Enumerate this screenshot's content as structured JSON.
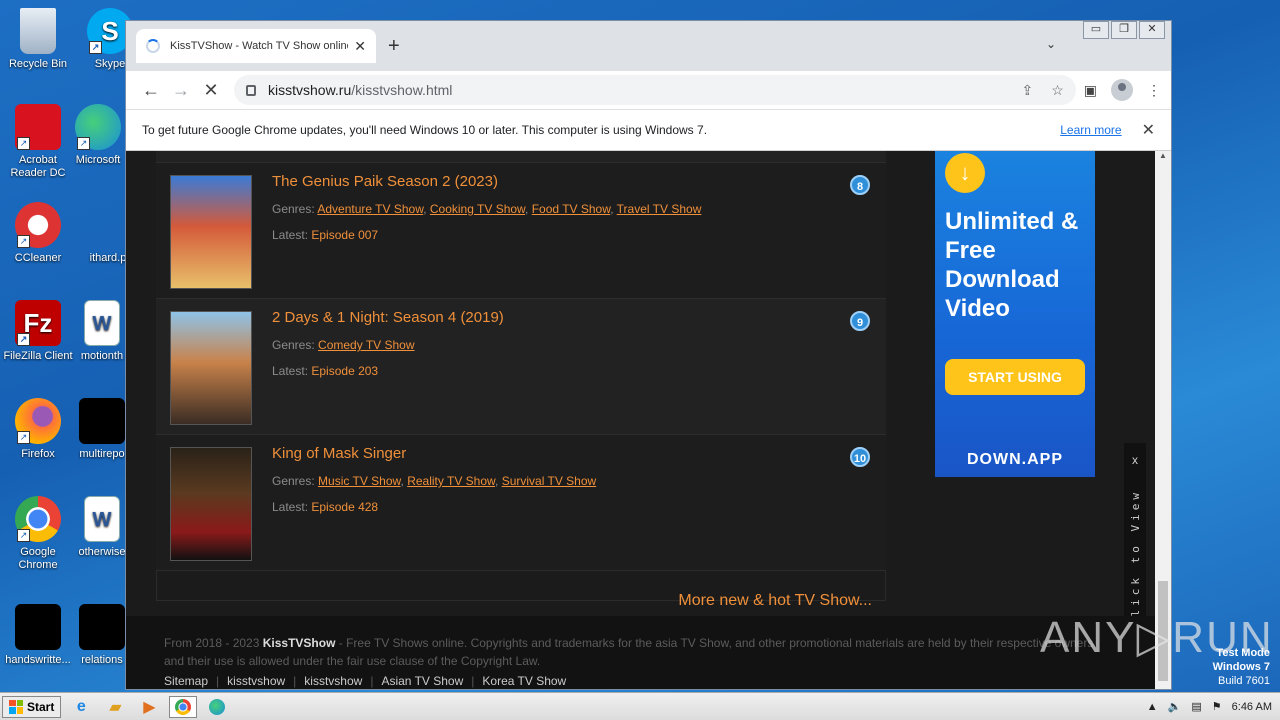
{
  "desktop": {
    "icons": [
      {
        "label": "Recycle Bin"
      },
      {
        "label": "Skype"
      },
      {
        "label": "Acrobat Reader DC"
      },
      {
        "label": "Microsoft"
      },
      {
        "label": "CCleaner"
      },
      {
        "label": "ithard.p"
      },
      {
        "label": "FileZilla Client"
      },
      {
        "label": "motionth"
      },
      {
        "label": "Firefox"
      },
      {
        "label": "multirepo"
      },
      {
        "label": "Google Chrome"
      },
      {
        "label": "otherwise"
      },
      {
        "label": "handswritte..."
      },
      {
        "label": "relations"
      }
    ]
  },
  "browser": {
    "tab_title": "KissTVShow - Watch TV Show online",
    "tab_close": "✕",
    "new_tab": "+",
    "tab_menu": "⌄",
    "window_controls": [
      "▭",
      "❐",
      "✕"
    ],
    "url_host": "kisstvshow.ru",
    "url_path": "/kisstvshow.html",
    "infobar_text": "To get future Google Chrome updates, you'll need Windows 10 or later. This computer is using Windows 7.",
    "infobar_link": "Learn more",
    "infobar_close": "✕"
  },
  "shows": [
    {
      "rank": "8",
      "title": "The Genius Paik Season 2 (2023)",
      "genres_label": "Genres:",
      "genres": [
        "Adventure TV Show",
        "Cooking TV Show",
        "Food TV Show",
        "Travel TV Show"
      ],
      "latest_label": "Latest:",
      "latest": "Episode 007"
    },
    {
      "rank": "9",
      "title": "2 Days & 1 Night: Season 4 (2019)",
      "genres_label": "Genres:",
      "genres": [
        "Comedy TV Show"
      ],
      "latest_label": "Latest:",
      "latest": "Episode 203"
    },
    {
      "rank": "10",
      "title": "King of Mask Singer",
      "genres_label": "Genres:",
      "genres": [
        "Music TV Show",
        "Reality TV Show",
        "Survival TV Show"
      ],
      "latest_label": "Latest:",
      "latest": "Episode 428"
    }
  ],
  "more_link": "More new & hot TV Show...",
  "footer": {
    "copy_prefix": "From 2018 - 2023 ",
    "brand": "KissTVShow",
    "copy_suffix": " - Free TV Shows online. Copyrights and trademarks for the asia TV Show, and other promotional materials are held by their respective owners and their use is allowed under the fair use clause of the Copyright Law.",
    "links": [
      "Sitemap",
      "kisstvshow",
      "kisstvshow",
      "Asian TV Show",
      "Korea TV Show"
    ]
  },
  "ad": {
    "headline": "Unlimited & Free Download Video",
    "cta": "START USING",
    "brand": "DOWN.APP"
  },
  "side_tab": {
    "close": "x",
    "text": "Click to View"
  },
  "taskbar": {
    "start": "Start",
    "time": "6:46 AM"
  },
  "watermark": {
    "line1": "Test Mode",
    "line2": "Windows 7",
    "line3": "Build 7601",
    "anyrun": "ANY▷RUN"
  }
}
